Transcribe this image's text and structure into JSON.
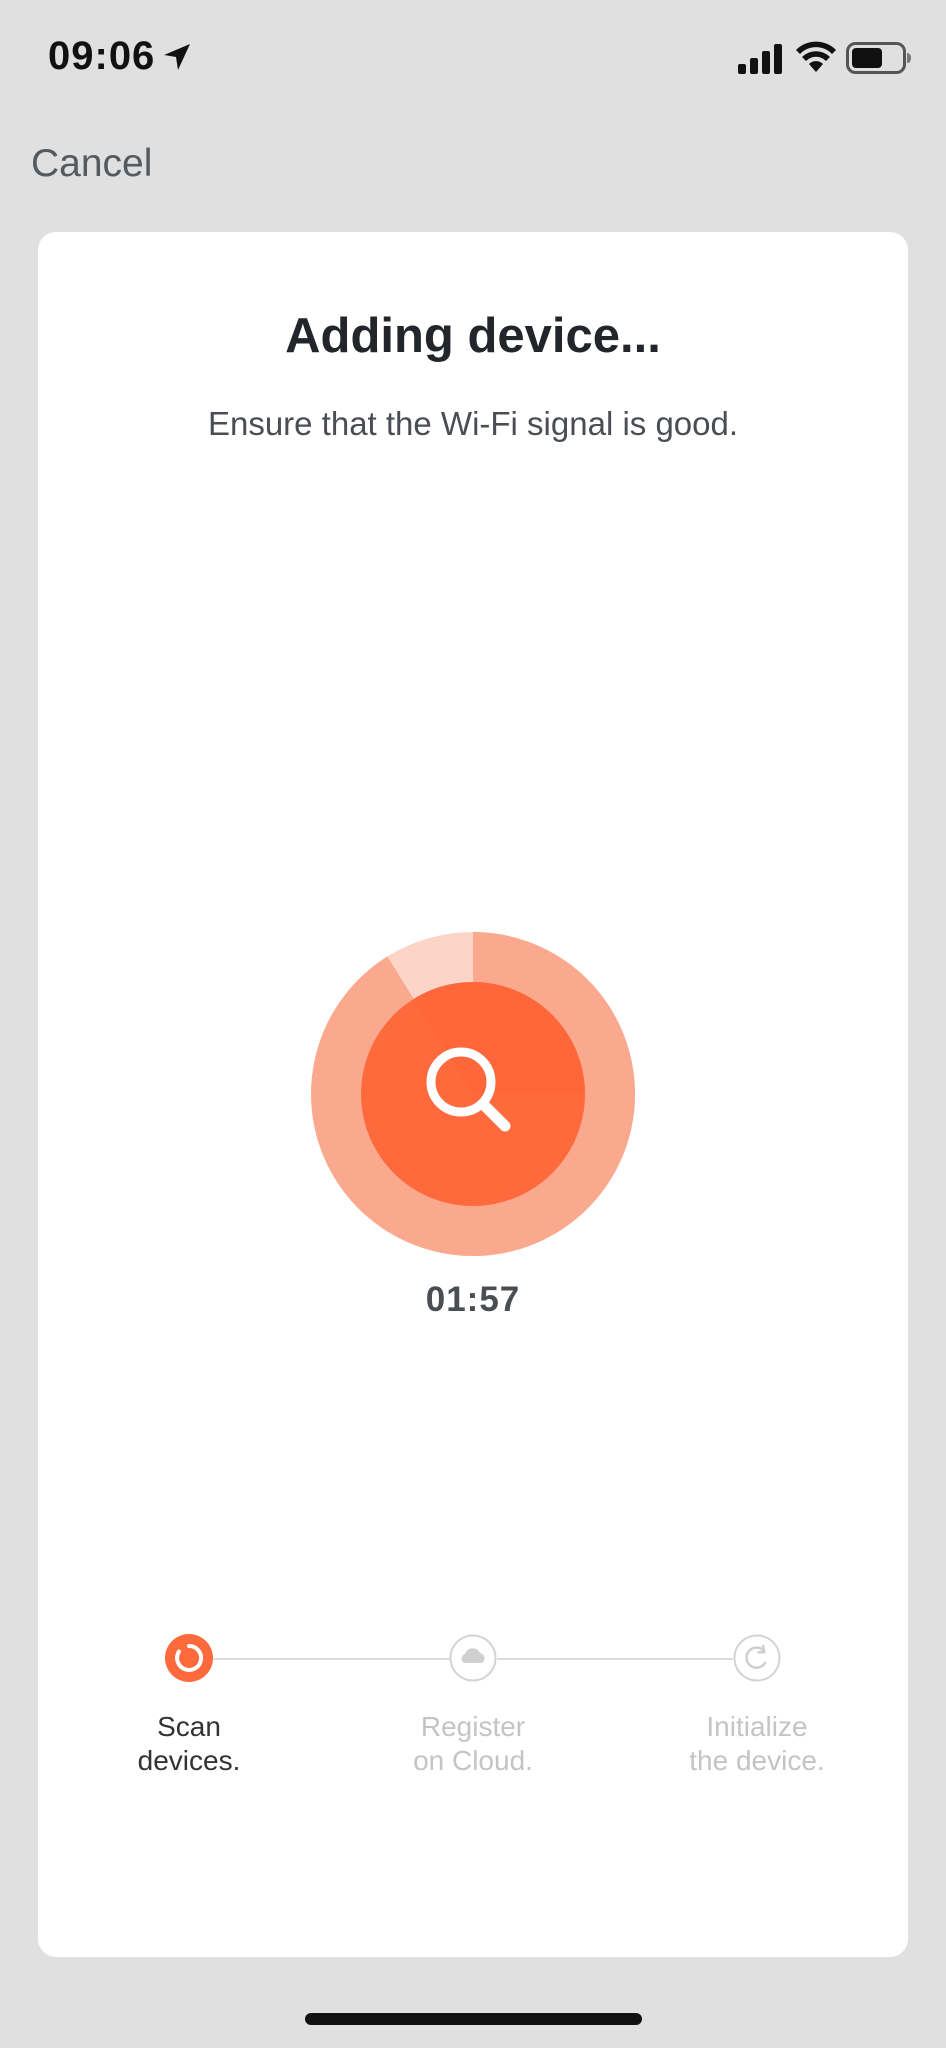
{
  "status_bar": {
    "time": "09:06",
    "location_icon": "location-arrow-icon",
    "signal_icon": "cellular-signal-icon",
    "wifi_icon": "wifi-icon",
    "battery_icon": "battery-icon"
  },
  "nav": {
    "cancel_label": "Cancel"
  },
  "main": {
    "title": "Adding device...",
    "subtitle": "Ensure that the Wi-Fi signal is good.",
    "scan_icon": "search-icon",
    "timer": "01:57"
  },
  "steps": [
    {
      "line1": "Scan",
      "line2": "devices.",
      "state": "active",
      "icon": "spinner-icon"
    },
    {
      "line1": "Register",
      "line2": "on Cloud.",
      "state": "pending",
      "icon": "cloud-icon"
    },
    {
      "line1": "Initialize",
      "line2": "the device.",
      "state": "pending",
      "icon": "refresh-icon"
    }
  ],
  "colors": {
    "accent": "#ff6a3d",
    "accent_light": "#fcd5c8",
    "background": "#e0e0e0",
    "card": "#ffffff",
    "inactive": "#c4c4c4"
  }
}
